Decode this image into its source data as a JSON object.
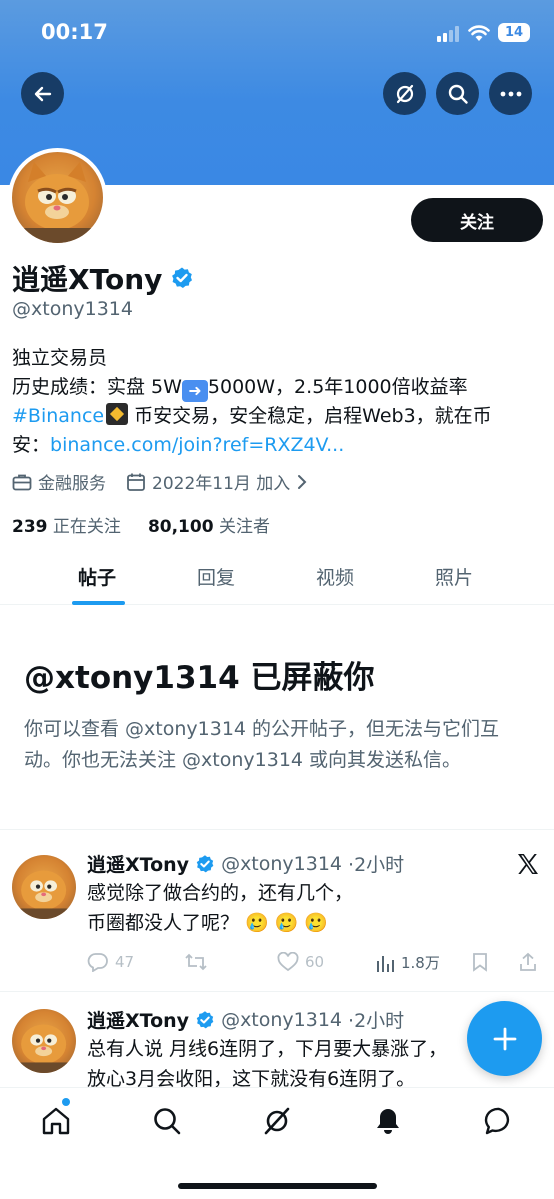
{
  "status_bar": {
    "time": "00:17",
    "battery": "14"
  },
  "profile": {
    "name": "逍遥XTony",
    "handle": "@xtony1314",
    "follow_label": "关注",
    "bio_line1": "独立交易员",
    "bio_line2_a": "历史成绩：实盘 5W",
    "bio_line2_b": "5000W，2.5年1000倍收益率",
    "bio_hashtag": "#Binance",
    "bio_line3_rest": " 币安交易，安全稳定，启程Web3，就在币",
    "bio_line4_a": "安：",
    "bio_link": "binance.com/join?ref=RXZ4V...",
    "category": "金融服务",
    "joined": "2022年11月 加入",
    "following_count": "239",
    "following_label": "正在关注",
    "followers_count": "80,100",
    "followers_label": "关注者"
  },
  "tabs": [
    {
      "label": "帖子",
      "active": true
    },
    {
      "label": "回复"
    },
    {
      "label": "视频"
    },
    {
      "label": "照片"
    }
  ],
  "blocked": {
    "title": "@xtony1314 已屏蔽你",
    "text": "你可以查看 @xtony1314 的公开帖子，但无法与它们互动。你也无法关注 @xtony1314 或向其发送私信。"
  },
  "tweets": [
    {
      "name": "逍遥XTony",
      "handle": "@xtony1314",
      "time": "·2小时",
      "line1": "感觉除了做合约的，还有几个，",
      "line2": "币圈都没人了呢？ 🥲 🥲 🥲",
      "replies": "47",
      "likes": "60",
      "views": "1.8万"
    },
    {
      "name": "逍遥XTony",
      "handle": "@xtony1314",
      "time": "·2小时",
      "line1": "总有人说 月线6连阴了，下月要大暴涨了，",
      "line2": "放心3月会收阳，这下就没有6连阴了。"
    }
  ],
  "colors": {
    "accent": "#1d9bf0",
    "banner": "#3d8ae3",
    "text": "#0f1419",
    "muted": "#536471"
  }
}
